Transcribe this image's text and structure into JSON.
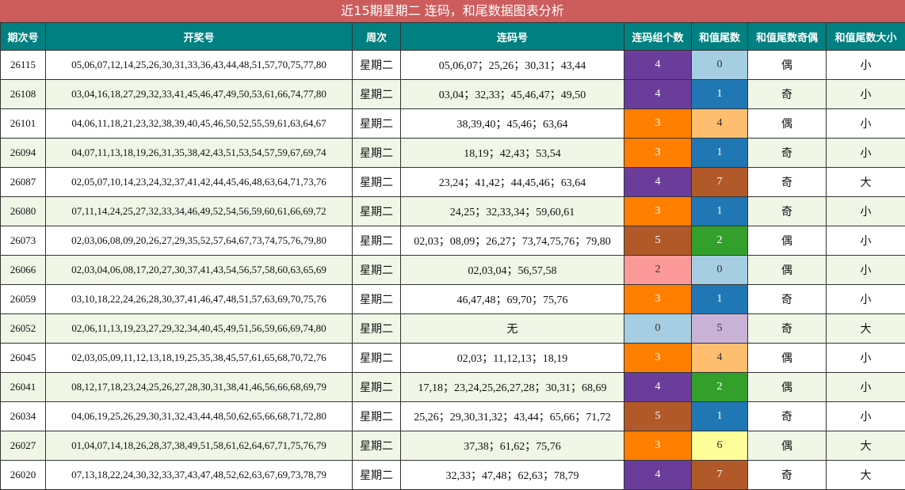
{
  "title": "近15期星期二 连码，和尾数据图表分析",
  "columns": [
    "期次号",
    "开奖号",
    "周次",
    "连码号",
    "连码组个数",
    "和值尾数",
    "和值尾数奇偶",
    "和值尾数大小"
  ],
  "colors": {
    "title_bg": "#cd5c5c",
    "header_bg": "#008080",
    "count": {
      "0": "#a6cee3",
      "2": "#fb9a99",
      "3": "#ff7f00",
      "4": "#6a3d9a",
      "5": "#b15928"
    },
    "tail": {
      "0": "#a6cee3",
      "1": "#1f78b4",
      "2": "#33a02c",
      "4": "#fdbf6f",
      "5": "#cab2d6",
      "6": "#ffff99",
      "7": "#b15928"
    }
  },
  "rows": [
    {
      "issue": "26115",
      "draw": "05,06,07,12,14,25,26,30,31,33,36,43,44,48,51,57,70,75,77,80",
      "week": "星期二",
      "consec": "05,06,07；25,26；30,31；43,44",
      "count": "4",
      "tail": "0",
      "parity": "偶",
      "size": "小"
    },
    {
      "issue": "26108",
      "draw": "03,04,16,18,27,29,32,33,41,45,46,47,49,50,53,61,66,74,77,80",
      "week": "星期二",
      "consec": "03,04；32,33；45,46,47；49,50",
      "count": "4",
      "tail": "1",
      "parity": "奇",
      "size": "小"
    },
    {
      "issue": "26101",
      "draw": "04,06,11,18,21,23,32,38,39,40,45,46,50,52,55,59,61,63,64,67",
      "week": "星期二",
      "consec": "38,39,40；45,46；63,64",
      "count": "3",
      "tail": "4",
      "parity": "偶",
      "size": "小"
    },
    {
      "issue": "26094",
      "draw": "04,07,11,13,18,19,26,31,35,38,42,43,51,53,54,57,59,67,69,74",
      "week": "星期二",
      "consec": "18,19；42,43；53,54",
      "count": "3",
      "tail": "1",
      "parity": "奇",
      "size": "小"
    },
    {
      "issue": "26087",
      "draw": "02,05,07,10,14,23,24,32,37,41,42,44,45,46,48,63,64,71,73,76",
      "week": "星期二",
      "consec": "23,24；41,42；44,45,46；63,64",
      "count": "4",
      "tail": "7",
      "parity": "奇",
      "size": "大"
    },
    {
      "issue": "26080",
      "draw": "07,11,14,24,25,27,32,33,34,46,49,52,54,56,59,60,61,66,69,72",
      "week": "星期二",
      "consec": "24,25；32,33,34；59,60,61",
      "count": "3",
      "tail": "1",
      "parity": "奇",
      "size": "小"
    },
    {
      "issue": "26073",
      "draw": "02,03,06,08,09,20,26,27,29,35,52,57,64,67,73,74,75,76,79,80",
      "week": "星期二",
      "consec": "02,03；08,09；26,27；73,74,75,76；79,80",
      "count": "5",
      "tail": "2",
      "parity": "偶",
      "size": "小"
    },
    {
      "issue": "26066",
      "draw": "02,03,04,06,08,17,20,27,30,37,41,43,54,56,57,58,60,63,65,69",
      "week": "星期二",
      "consec": "02,03,04；56,57,58",
      "count": "2",
      "tail": "0",
      "parity": "偶",
      "size": "小"
    },
    {
      "issue": "26059",
      "draw": "03,10,18,22,24,26,28,30,37,41,46,47,48,51,57,63,69,70,75,76",
      "week": "星期二",
      "consec": "46,47,48；69,70；75,76",
      "count": "3",
      "tail": "1",
      "parity": "奇",
      "size": "小"
    },
    {
      "issue": "26052",
      "draw": "02,06,11,13,19,23,27,29,32,34,40,45,49,51,56,59,66,69,74,80",
      "week": "星期二",
      "consec": "无",
      "count": "0",
      "tail": "5",
      "parity": "奇",
      "size": "大"
    },
    {
      "issue": "26045",
      "draw": "02,03,05,09,11,12,13,18,19,25,35,38,45,57,61,65,68,70,72,76",
      "week": "星期二",
      "consec": "02,03；11,12,13；18,19",
      "count": "3",
      "tail": "4",
      "parity": "偶",
      "size": "小"
    },
    {
      "issue": "26041",
      "draw": "08,12,17,18,23,24,25,26,27,28,30,31,38,41,46,56,66,68,69,79",
      "week": "星期二",
      "consec": "17,18；23,24,25,26,27,28；30,31；68,69",
      "count": "4",
      "tail": "2",
      "parity": "偶",
      "size": "小"
    },
    {
      "issue": "26034",
      "draw": "04,06,19,25,26,29,30,31,32,43,44,48,50,62,65,66,68,71,72,80",
      "week": "星期二",
      "consec": "25,26；29,30,31,32；43,44；65,66；71,72",
      "count": "5",
      "tail": "1",
      "parity": "奇",
      "size": "小"
    },
    {
      "issue": "26027",
      "draw": "01,04,07,14,18,26,28,37,38,49,51,58,61,62,64,67,71,75,76,79",
      "week": "星期二",
      "consec": "37,38；61,62；75,76",
      "count": "3",
      "tail": "6",
      "parity": "偶",
      "size": "大"
    },
    {
      "issue": "26020",
      "draw": "07,13,18,22,24,30,32,33,37,43,47,48,52,62,63,67,69,73,78,79",
      "week": "星期二",
      "consec": "32,33；47,48；62,63；78,79",
      "count": "4",
      "tail": "7",
      "parity": "奇",
      "size": "大"
    }
  ]
}
